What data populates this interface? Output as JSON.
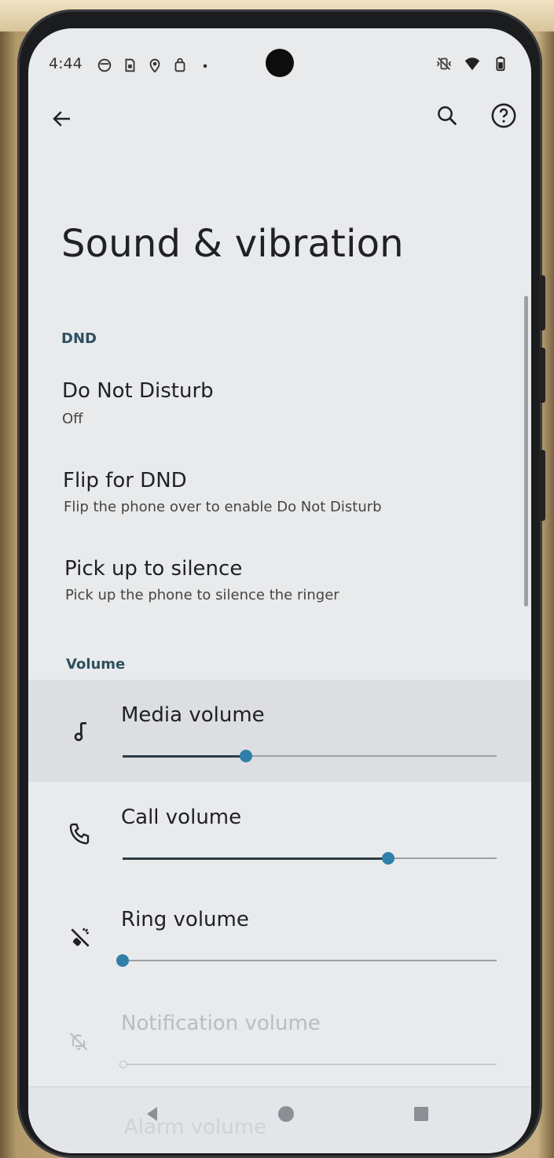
{
  "status_bar": {
    "time": "4:44",
    "left_icons": [
      "notification-face-icon",
      "sim-icon",
      "location-pin-icon",
      "shopping-bag-icon",
      "more-dot-icon"
    ],
    "right_icons": [
      "vibrate-off-icon",
      "wifi-icon",
      "battery-icon"
    ]
  },
  "app_bar": {
    "back_icon": "arrow-left-icon",
    "search_icon": "search-icon",
    "help_icon": "help-circle-icon"
  },
  "page": {
    "title": "Sound & vibration"
  },
  "sections": {
    "dnd": {
      "header": "DND",
      "items": [
        {
          "title": "Do Not Disturb",
          "summary": "Off"
        },
        {
          "title": "Flip for DND",
          "summary": "Flip the phone over to enable Do Not Disturb"
        },
        {
          "title": "Pick up to silence",
          "summary": "Pick up the phone to silence the ringer"
        }
      ]
    },
    "volume": {
      "header": "Volume",
      "sliders": [
        {
          "label": "Media volume",
          "icon": "music-note-icon",
          "value": 0.33,
          "enabled": true
        },
        {
          "label": "Call volume",
          "icon": "phone-icon",
          "value": 0.71,
          "enabled": true
        },
        {
          "label": "Ring volume",
          "icon": "ring-vibrate-icon",
          "value": 0.0,
          "enabled": true
        },
        {
          "label": "Notification volume",
          "icon": "bell-off-icon",
          "value": 0.0,
          "enabled": false
        }
      ],
      "partially_visible_label": "Alarm volume"
    }
  },
  "nav_bar": {
    "back": "nav-back-icon",
    "home": "nav-home-icon",
    "recents": "nav-recents-icon"
  },
  "colors": {
    "accent": "#2f7fa8",
    "section_header": "#2f4f5f",
    "screen_bg": "#e8eaec"
  }
}
